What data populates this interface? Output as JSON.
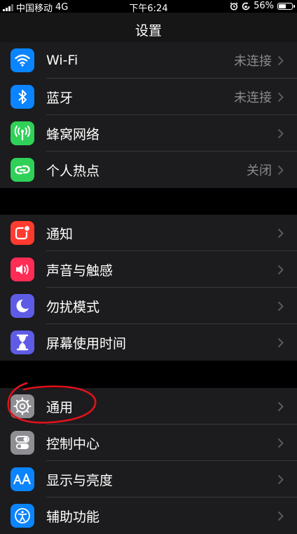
{
  "status": {
    "carrier": "中国移动",
    "network": "4G",
    "time": "下午6:24",
    "battery": "56%",
    "battery_level": 0.56
  },
  "header": {
    "title": "设置"
  },
  "groups": [
    {
      "rows": [
        {
          "label": "Wi-Fi",
          "value": "未连接",
          "icon": "wifi-icon",
          "color": "#0a84ff"
        },
        {
          "label": "蓝牙",
          "value": "未连接",
          "icon": "bluetooth-icon",
          "color": "#0a84ff"
        },
        {
          "label": "蜂窝网络",
          "value": "",
          "icon": "cellular-icon",
          "color": "#30d158"
        },
        {
          "label": "个人热点",
          "value": "关闭",
          "icon": "hotspot-icon",
          "color": "#30d158"
        }
      ]
    },
    {
      "rows": [
        {
          "label": "通知",
          "value": "",
          "icon": "notification-icon",
          "color": "#ff3b30"
        },
        {
          "label": "声音与触感",
          "value": "",
          "icon": "sound-icon",
          "color": "#ff2d55"
        },
        {
          "label": "勿扰模式",
          "value": "",
          "icon": "moon-icon",
          "color": "#5e5ce6"
        },
        {
          "label": "屏幕使用时间",
          "value": "",
          "icon": "hourglass-icon",
          "color": "#5e5ce6"
        }
      ]
    },
    {
      "rows": [
        {
          "label": "通用",
          "value": "",
          "icon": "gear-icon",
          "color": "#8e8e93"
        },
        {
          "label": "控制中心",
          "value": "",
          "icon": "toggles-icon",
          "color": "#8e8e93"
        },
        {
          "label": "显示与亮度",
          "value": "",
          "icon": "text-size-icon",
          "color": "#0a84ff"
        },
        {
          "label": "辅助功能",
          "value": "",
          "icon": "accessibility-icon",
          "color": "#0a84ff"
        }
      ]
    }
  ],
  "annotation_color": "#e0121b"
}
